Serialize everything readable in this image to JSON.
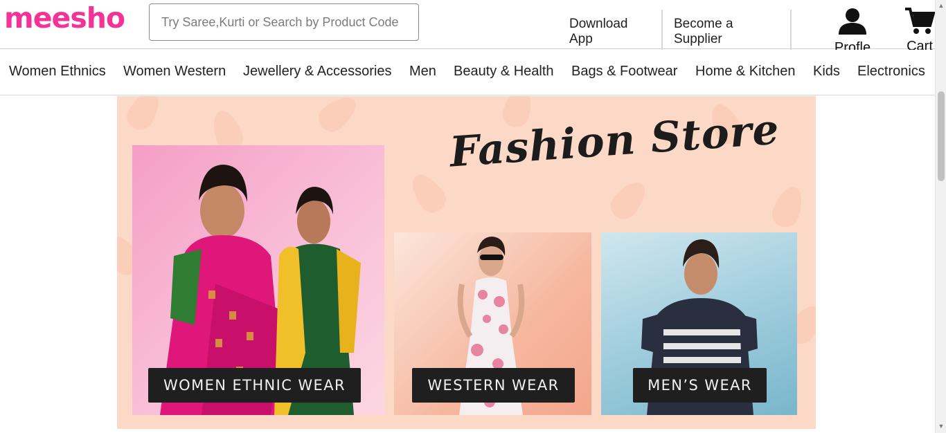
{
  "header": {
    "logo": "meesho",
    "search_placeholder": "Try Saree,Kurti or Search by Product Code",
    "download": [
      "Download",
      "App"
    ],
    "supplier": [
      "Become a",
      "Supplier"
    ],
    "profile_label": "Profle",
    "cart_label": "Cart",
    "profile_icon": "user-icon",
    "cart_icon": "cart-icon"
  },
  "nav": {
    "items": [
      "Women Ethnics",
      "Women Western",
      "Jewellery & Accessories",
      "Men",
      "Beauty & Health",
      "Bags & Footwear",
      "Home & Kitchen",
      "Kids",
      "Electronics"
    ]
  },
  "banner": {
    "title": "Fashion Store",
    "tiles": [
      {
        "label": "WOMEN ETHNIC WEAR"
      },
      {
        "label": "WESTERN WEAR"
      },
      {
        "label": "MEN’S WEAR"
      }
    ]
  },
  "colors": {
    "brand": "#f43397",
    "banner_bg": "#fcd8c6"
  }
}
